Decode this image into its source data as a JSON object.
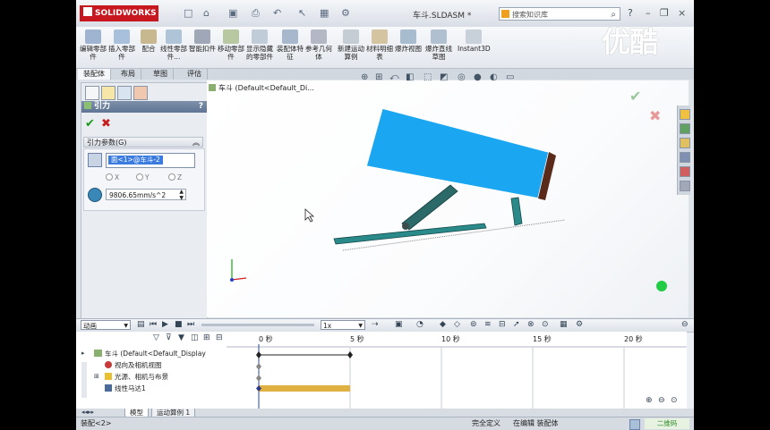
{
  "titlebar": {
    "app_name": "SOLIDWORKS",
    "document_title": "车斗.SLDASM *",
    "search_placeholder": "搜索知识库"
  },
  "ribbon": {
    "buttons": [
      "编辑零部件",
      "插入零部件",
      "配合",
      "线性零部件...",
      "智能扣件",
      "移动零部件",
      "显示隐藏的零部件",
      "装配体特征",
      "参考几何体",
      "新建运动算例",
      "材料明细表",
      "爆炸视图",
      "爆炸直线草图",
      "Instant3D"
    ]
  },
  "command_tabs": [
    "装配体",
    "布局",
    "草图",
    "评估"
  ],
  "property_manager": {
    "title": "引力",
    "help": "?",
    "group_title": "引力参数(G)",
    "direction_value": "面<1>@车斗-2",
    "axis_x": "X",
    "axis_y": "Y",
    "axis_z": "Z",
    "gravity_value": "9806.65mm/s^2"
  },
  "viewport": {
    "tree_title": "车斗  (Default<Default_Di..."
  },
  "motion_manager": {
    "study_type": "动画",
    "combo_value": "1x",
    "tree": [
      "车斗  (Default<Default_Display",
      "视向及相机视图",
      "光源、相机与布景",
      "线性马达1"
    ],
    "time_labels": [
      "0 秒",
      "5 秒",
      "10 秒",
      "15 秒",
      "20 秒"
    ],
    "tabs": [
      "模型",
      "运动算例 1"
    ]
  },
  "statusbar": {
    "left": "装配<2>",
    "definition": "完全定义",
    "mode": "在编辑 装配体"
  },
  "watermark": "优酷",
  "corner_logo": "二维码"
}
